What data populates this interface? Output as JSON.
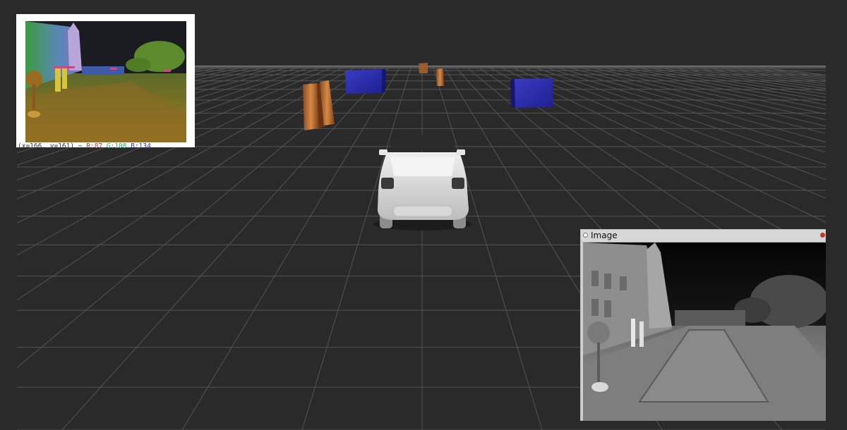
{
  "scene": {
    "background": "#2a2a2b",
    "grid_color": "#545454",
    "car_color": "#d9d9d9",
    "box_colors": {
      "pedestrian": "#b8692c",
      "vehicle": "#2d2fa8"
    }
  },
  "camera_panel": {
    "pixel_info": {
      "prefix": "(x=166, y=161) ~",
      "r": "R:87",
      "g": "G:108",
      "b": "B:134"
    }
  },
  "image_window": {
    "title": "Image"
  }
}
